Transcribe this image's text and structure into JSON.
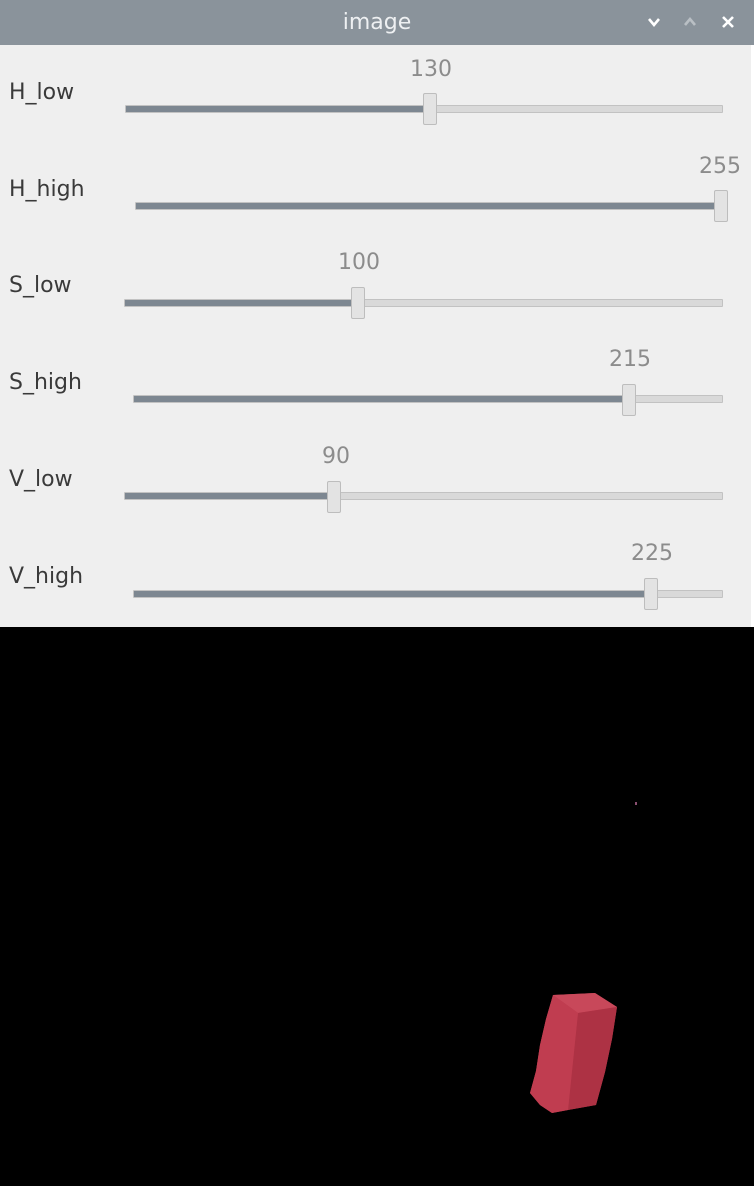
{
  "window": {
    "title": "image",
    "controls": [
      "minimize-icon",
      "maximize-icon",
      "close-icon"
    ]
  },
  "trackbars": [
    {
      "label": "H_low",
      "value": "130",
      "fraction": 0.5098
    },
    {
      "label": "H_high",
      "value": "255",
      "fraction": 1.0
    },
    {
      "label": "S_low",
      "value": "100",
      "fraction": 0.3922
    },
    {
      "label": "S_high",
      "value": "215",
      "fraction": 0.8431
    },
    {
      "label": "V_low",
      "value": "90",
      "fraction": 0.3529
    },
    {
      "label": "V_high",
      "value": "225",
      "fraction": 0.8824
    }
  ],
  "colors": {
    "titlebar": "#8a939b",
    "panel": "#efefef",
    "slider_fill": "#7d8791",
    "slider_track": "#d9d9d9",
    "mask_background": "#000000",
    "object": "#b8384b"
  }
}
